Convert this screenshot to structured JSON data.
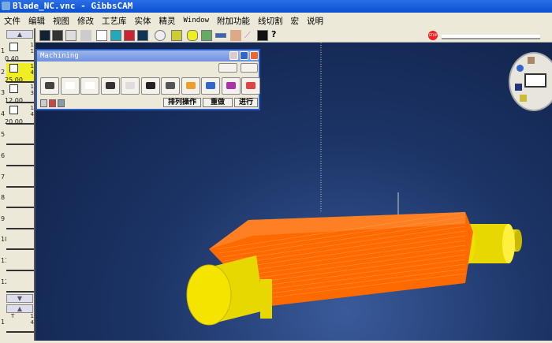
{
  "window": {
    "title": "Blade_NC.vnc - GibbsCAM"
  },
  "menu": [
    "文件",
    "编辑",
    "视图",
    "修改",
    "工艺库",
    "实体",
    "精灵",
    "Window",
    "附加功能",
    "线切割",
    "宏",
    "说明"
  ],
  "toolbar_icons": [
    "view-box-icon",
    "text-icon",
    "cube-icon",
    "shade-icon",
    "point-icon",
    "tool-icon",
    "color-icon",
    "moon-icon",
    "toggle-icon",
    "solid-icon",
    "render-icon",
    "model-icon",
    "measure-icon",
    "material-icon",
    "cursor-icon",
    "select-icon",
    "help-icon"
  ],
  "stop_label": "STOP",
  "tools": [
    {
      "num": "1",
      "value": "0.40",
      "side": [
        "1",
        "1"
      ]
    },
    {
      "num": "2",
      "value": "25.00",
      "side": [
        "1",
        "4"
      ],
      "selected": true
    },
    {
      "num": "3",
      "value": "12.00",
      "side": [
        "1",
        "3"
      ]
    },
    {
      "num": "4",
      "value": "20.00",
      "side": [
        "1",
        "4"
      ]
    },
    {
      "num": "5"
    },
    {
      "num": "6"
    },
    {
      "num": "7"
    },
    {
      "num": "8"
    },
    {
      "num": "9"
    },
    {
      "num": "10"
    },
    {
      "num": "11"
    },
    {
      "num": "12"
    }
  ],
  "process": {
    "num": "1",
    "label": "T",
    "side": [
      "1",
      "4"
    ]
  },
  "palette": {
    "title": "Machining",
    "tools": [
      "holes-icon",
      "contour-icon",
      "roughing-icon",
      "finishing-icon",
      "lathe-icon",
      "thread-icon",
      "mill-icon",
      "surface-icon",
      "vericut-icon",
      "sim-icon",
      "cut-icon"
    ],
    "buttons": [
      "排列操作",
      "重做",
      "进行"
    ]
  }
}
